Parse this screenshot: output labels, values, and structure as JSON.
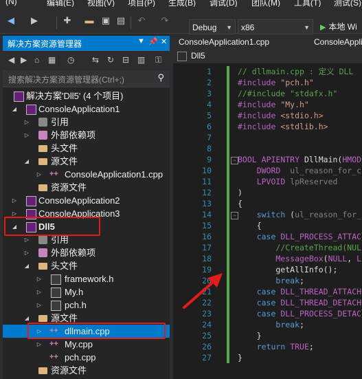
{
  "menubar": {
    "items": [
      "(N)",
      "编辑(E)",
      "视图(V)",
      "项目(P)",
      "生成(B)",
      "调试(D)",
      "团队(M)",
      "工具(T)",
      "测试(S)"
    ]
  },
  "toolbar": {
    "config": "Debug",
    "platform": "x86",
    "run_label": "本地 Wi"
  },
  "solution_explorer": {
    "title": "解决方案资源管理器",
    "search_placeholder": "搜索解决方案资源管理器(Ctrl+;)",
    "rows": [
      {
        "label": "解决方案'Dll5' (4 个项目)",
        "icon": "solution-icon"
      },
      {
        "label": "ConsoleApplication1",
        "icon": "project-icon"
      },
      {
        "label": "引用",
        "icon": "references-icon"
      },
      {
        "label": "外部依赖项",
        "icon": "external-deps-icon"
      },
      {
        "label": "头文件",
        "icon": "folder-icon"
      },
      {
        "label": "源文件",
        "icon": "folder-icon"
      },
      {
        "label": "ConsoleApplication1.cpp",
        "icon": "cpp-file-icon"
      },
      {
        "label": "资源文件",
        "icon": "folder-icon"
      },
      {
        "label": "ConsoleApplication2",
        "icon": "project-icon"
      },
      {
        "label": "ConsoleApplication3",
        "icon": "project-icon"
      },
      {
        "label": "Dll5",
        "icon": "project-icon"
      },
      {
        "label": "引用",
        "icon": "references-icon"
      },
      {
        "label": "外部依赖项",
        "icon": "external-deps-icon"
      },
      {
        "label": "头文件",
        "icon": "folder-icon"
      },
      {
        "label": "framework.h",
        "icon": "header-file-icon"
      },
      {
        "label": "My.h",
        "icon": "header-file-icon"
      },
      {
        "label": "pch.h",
        "icon": "header-file-icon"
      },
      {
        "label": "源文件",
        "icon": "folder-icon"
      },
      {
        "label": "dllmain.cpp",
        "icon": "cpp-file-icon"
      },
      {
        "label": "My.cpp",
        "icon": "cpp-file-icon"
      },
      {
        "label": "pch.cpp",
        "icon": "cpp-file-icon"
      },
      {
        "label": "资源文件",
        "icon": "folder-icon"
      }
    ]
  },
  "editor": {
    "tabs": [
      "ConsoleApplication1.cpp",
      "ConsoleApplica"
    ],
    "nav_project": "Dll5",
    "line_numbers": [
      "1",
      "2",
      "3",
      "4",
      "5",
      "6",
      "7",
      "8",
      "9",
      "10",
      "11",
      "12",
      "13",
      "14",
      "15",
      "16",
      "17",
      "18",
      "19",
      "20",
      "21",
      "22",
      "23",
      "24",
      "25",
      "26",
      "27"
    ],
    "colors": {
      "comment": "#57a64a",
      "string": "#d69d85",
      "keyword": "#569cd6",
      "macro": "#bd63c5",
      "text": "#dcdcdc",
      "type": "#4ec9b0",
      "func": "#dcdcaa",
      "param": "#9cdcfe"
    }
  }
}
